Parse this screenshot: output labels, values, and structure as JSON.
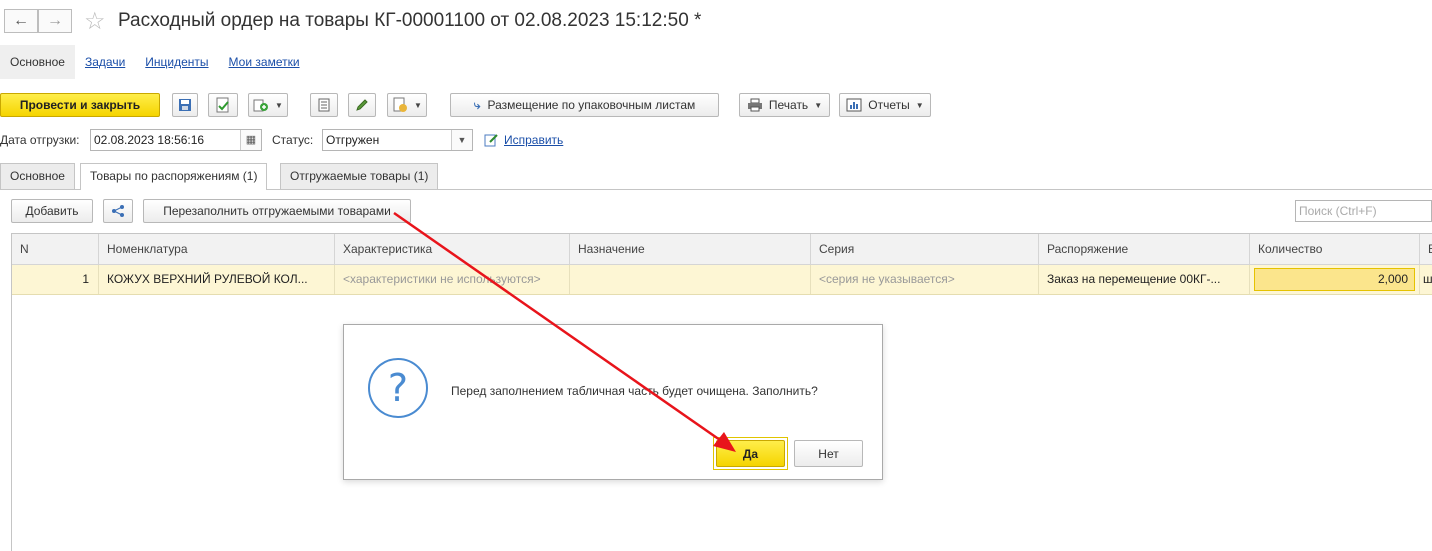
{
  "window": {
    "title": "Расходный ордер на товары КГ-00001100 от 02.08.2023 15:12:50 *"
  },
  "nav_tabs": [
    {
      "label": "Основное",
      "active": true
    },
    {
      "label": "Задачи",
      "active": false
    },
    {
      "label": "Инциденты",
      "active": false
    },
    {
      "label": "Мои заметки",
      "active": false
    }
  ],
  "toolbar": {
    "post_close": "Провести и закрыть",
    "placement": "Размещение по упаковочным листам",
    "print": "Печать",
    "reports": "Отчеты"
  },
  "form": {
    "ship_date_label": "Дата отгрузки:",
    "ship_date_value": "02.08.2023 18:56:16",
    "status_label": "Статус:",
    "status_value": "Отгружен",
    "fix_link": "Исправить"
  },
  "tabs": [
    {
      "label": "Основное",
      "active": false
    },
    {
      "label": "Товары по распоряжениям (1)",
      "active": true
    },
    {
      "label": "Отгружаемые товары (1)",
      "active": false
    }
  ],
  "table_toolbar": {
    "add": "Добавить",
    "refill": "Перезаполнить отгружаемыми товарами",
    "search_placeholder": "Поиск (Ctrl+F)"
  },
  "table": {
    "columns": [
      "N",
      "Номенклатура",
      "Характеристика",
      "Назначение",
      "Серия",
      "Распоряжение",
      "Количество",
      "Е"
    ],
    "rows": [
      {
        "n": "1",
        "nomenclature": "КОЖУХ ВЕРХНИЙ РУЛЕВОЙ КОЛ...",
        "characteristic": "<характеристики не используются>",
        "purpose": "",
        "series": "<серия не указывается>",
        "order": "Заказ на перемещение 00КГ-...",
        "quantity": "2,000",
        "unit": "ш"
      }
    ]
  },
  "dialog": {
    "message": "Перед заполнением табличная часть будет очищена. Заполнить?",
    "yes": "Да",
    "no": "Нет"
  },
  "colors": {
    "accent_yellow": "#f5d400",
    "link_blue": "#1a4ea8",
    "arrow_red": "#e8141b",
    "row_highlight": "#fdf6d4"
  }
}
